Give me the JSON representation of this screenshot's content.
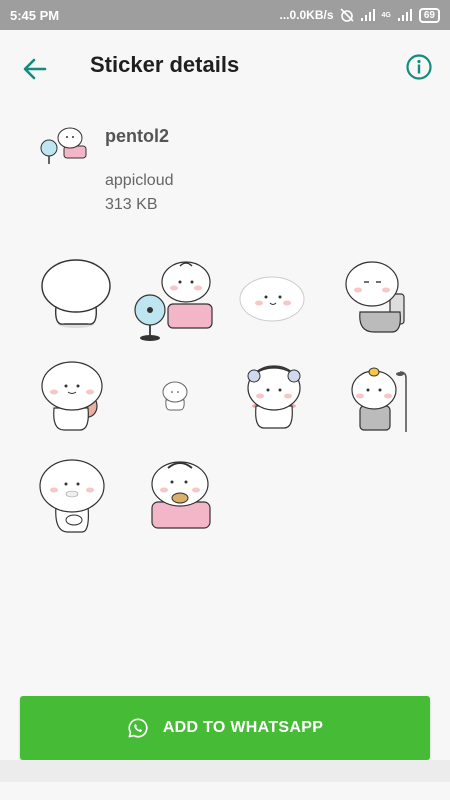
{
  "status_bar": {
    "time": "5:45 PM",
    "speed": "...0.0KB/s",
    "network_type": "4G",
    "battery": "69"
  },
  "app_bar": {
    "title": "Sticker details"
  },
  "pack": {
    "name": "pentol2",
    "publisher": "appicloud",
    "size": "313 KB"
  },
  "stickers": [
    {
      "name": "plain-blob"
    },
    {
      "name": "fan-chair-blob"
    },
    {
      "name": "flat-blob"
    },
    {
      "name": "toilet-blob"
    },
    {
      "name": "backpack-blob"
    },
    {
      "name": "tiny-blob"
    },
    {
      "name": "towel-blob"
    },
    {
      "name": "shower-blob"
    },
    {
      "name": "thinking-blob"
    },
    {
      "name": "eating-chair-blob"
    }
  ],
  "button": {
    "label": "ADD TO WHATSAPP"
  },
  "colors": {
    "accent": "#128c7e",
    "button": "#46bb36",
    "status_bar": "#9e9e9e"
  },
  "icons": {
    "back": "arrow-back-icon",
    "info": "info-icon",
    "whatsapp": "whatsapp-icon"
  }
}
